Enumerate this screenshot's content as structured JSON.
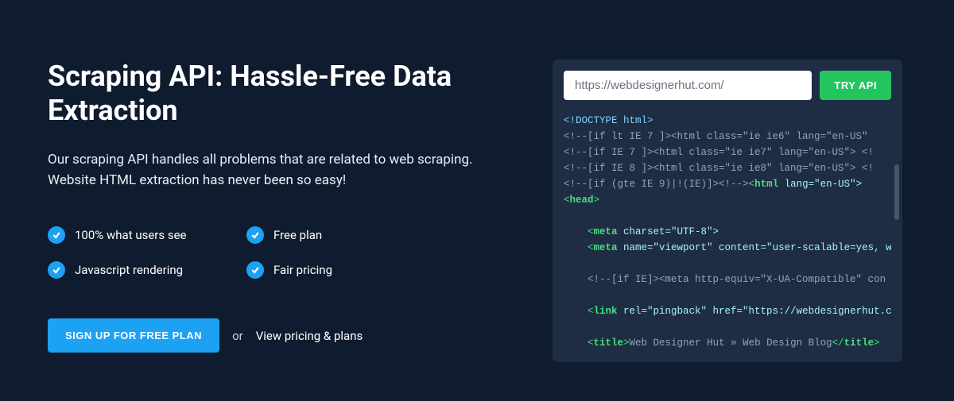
{
  "headline": "Scraping API: Hassle-Free Data Extraction",
  "subtext": "Our scraping API handles all problems that are related to web scraping. Website HTML extraction has never been so easy!",
  "features": [
    "100% what users see",
    "Free plan",
    "Javascript rendering",
    "Fair pricing"
  ],
  "cta": {
    "signup_label": "SIGN UP FOR FREE PLAN",
    "or_text": "or",
    "pricing_link": "View pricing & plans"
  },
  "api_demo": {
    "url_value": "https://webdesignerhut.com/",
    "try_label": "TRY API",
    "code_lines": [
      {
        "tokens": [
          {
            "t": "<!DOCTYPE html>",
            "c": "tok-doctype"
          }
        ]
      },
      {
        "tokens": [
          {
            "t": "<!--[if lt IE 7 ]><html class=\"ie ie6\" lang=\"en-US\"",
            "c": "tok-comment"
          }
        ]
      },
      {
        "tokens": [
          {
            "t": "<!--[if IE 7 ]><html class=\"ie ie7\" lang=\"en-US\"> <!",
            "c": "tok-comment"
          }
        ]
      },
      {
        "tokens": [
          {
            "t": "<!--[if IE 8 ]><html class=\"ie ie8\" lang=\"en-US\"> <!",
            "c": "tok-comment"
          }
        ]
      },
      {
        "tokens": [
          {
            "t": "<!--[if (gte IE 9)|!(IE)]><!-->",
            "c": "tok-comment"
          },
          {
            "t": "<",
            "c": "tok-punct"
          },
          {
            "t": "html",
            "c": "tok-tag"
          },
          {
            "t": " lang=\"en-US\">",
            "c": "tok-attr"
          }
        ]
      },
      {
        "tokens": [
          {
            "t": "<",
            "c": "tok-punct"
          },
          {
            "t": "head",
            "c": "tok-tag"
          },
          {
            "t": ">",
            "c": "tok-punct"
          }
        ]
      },
      {
        "tokens": [
          {
            "t": "",
            "c": ""
          }
        ]
      },
      {
        "tokens": [
          {
            "t": "    <",
            "c": "tok-punct"
          },
          {
            "t": "meta",
            "c": "tok-tag"
          },
          {
            "t": " charset=\"UTF-8\">",
            "c": "tok-attr"
          }
        ]
      },
      {
        "tokens": [
          {
            "t": "    <",
            "c": "tok-punct"
          },
          {
            "t": "meta",
            "c": "tok-tag"
          },
          {
            "t": " name=\"viewport\" content=\"user-scalable=yes, w",
            "c": "tok-attr"
          }
        ]
      },
      {
        "tokens": [
          {
            "t": "",
            "c": ""
          }
        ]
      },
      {
        "tokens": [
          {
            "t": "    <!--[if IE]><meta http-equiv=\"X-UA-Compatible\" con",
            "c": "tok-comment"
          }
        ]
      },
      {
        "tokens": [
          {
            "t": "",
            "c": ""
          }
        ]
      },
      {
        "tokens": [
          {
            "t": "    <",
            "c": "tok-punct"
          },
          {
            "t": "link",
            "c": "tok-tag"
          },
          {
            "t": " rel=\"pingback\" href=\"https://webdesignerhut.c",
            "c": "tok-attr"
          }
        ]
      },
      {
        "tokens": [
          {
            "t": "",
            "c": ""
          }
        ]
      },
      {
        "tokens": [
          {
            "t": "    <",
            "c": "tok-punct"
          },
          {
            "t": "title",
            "c": "tok-tag"
          },
          {
            "t": ">",
            "c": "tok-punct"
          },
          {
            "t": "Web Designer Hut » Web Design Blog",
            "c": "tok-comment"
          },
          {
            "t": "</",
            "c": "tok-punct"
          },
          {
            "t": "title",
            "c": "tok-tag"
          },
          {
            "t": ">",
            "c": "tok-punct"
          }
        ]
      }
    ]
  }
}
